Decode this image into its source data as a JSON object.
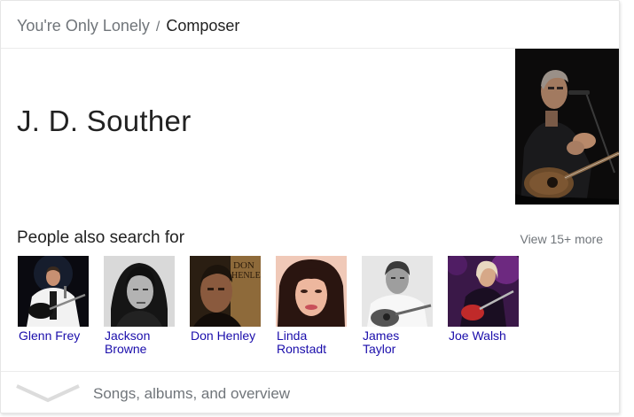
{
  "breadcrumb": {
    "song": "You're Only Lonely",
    "separator": "/",
    "role": "Composer"
  },
  "entity": {
    "name": "J. D. Souther"
  },
  "people_also_search": {
    "heading": "People also search for",
    "view_more": "View 15+ more",
    "people": [
      {
        "name_line1": "Glenn Frey",
        "name_line2": ""
      },
      {
        "name_line1": "Jackson",
        "name_line2": "Browne"
      },
      {
        "name_line1": "Don Henley",
        "name_line2": ""
      },
      {
        "name_line1": "Linda",
        "name_line2": "Ronstadt"
      },
      {
        "name_line1": "James",
        "name_line2": "Taylor"
      },
      {
        "name_line1": "Joe Walsh",
        "name_line2": ""
      }
    ],
    "album_text_1": "DON",
    "album_text_2": "HENLEY"
  },
  "footer": {
    "label": "Songs, albums, and overview"
  },
  "colors": {
    "link": "#1a0dab",
    "muted": "#70757a",
    "text": "#222222",
    "divider": "#ebebeb"
  },
  "icons": {
    "expand": "chevron-down-icon"
  }
}
